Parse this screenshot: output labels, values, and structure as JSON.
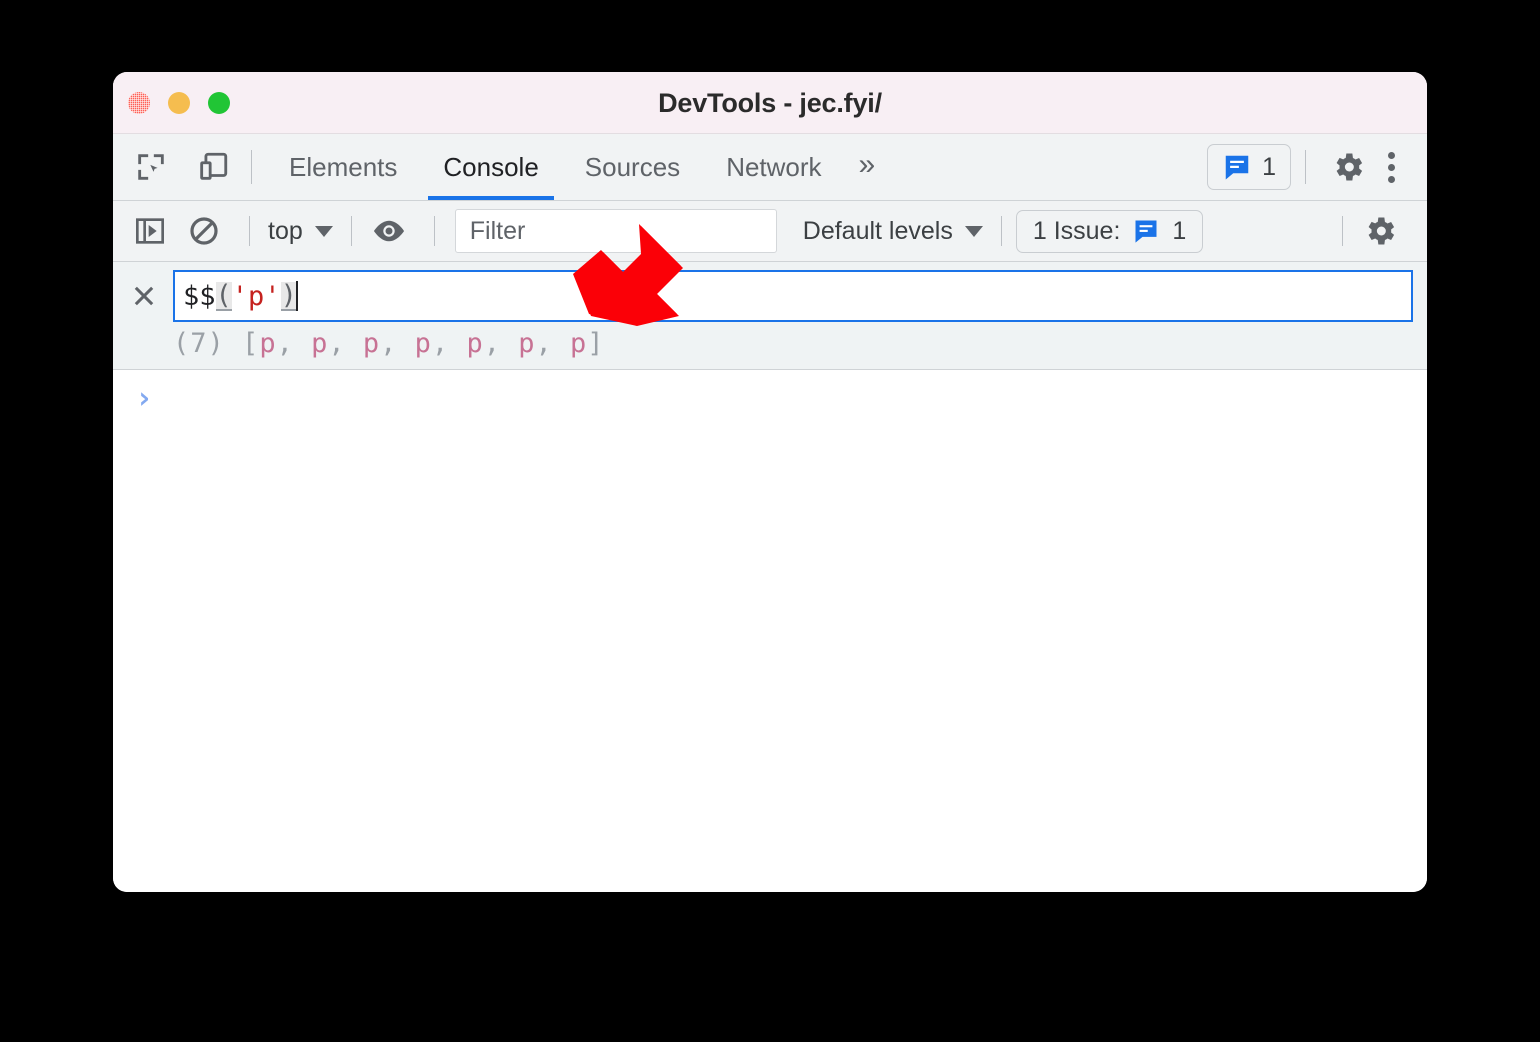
{
  "window": {
    "title": "DevTools - jec.fyi/",
    "traffic_lights": [
      "close",
      "minimize",
      "maximize"
    ]
  },
  "main_tabbar": {
    "inspect_icon": "inspect-element-icon",
    "device_icon": "device-toolbar-icon",
    "tabs": [
      {
        "label": "Elements",
        "active": false
      },
      {
        "label": "Console",
        "active": true
      },
      {
        "label": "Sources",
        "active": false
      },
      {
        "label": "Network",
        "active": false
      }
    ],
    "more_tabs": "»",
    "issues_chip": {
      "icon": "issues-bubble-icon",
      "count": "1"
    },
    "settings_icon": "gear-icon",
    "more_icon": "more-vertical-icon"
  },
  "console_toolbar": {
    "sidebar_toggle_icon": "console-sidebar-icon",
    "clear_console_icon": "clear-console-icon",
    "context_selector": {
      "value": "top",
      "caret": "chevron-down-icon"
    },
    "live_expression_icon": "eye-icon",
    "filter": {
      "placeholder": "Filter",
      "value": ""
    },
    "levels_selector": {
      "value": "Default levels",
      "caret": "chevron-down-icon"
    },
    "issue_counter": {
      "label": "1 Issue:",
      "icon": "issues-bubble-icon",
      "count": "1"
    },
    "settings_icon": "gear-icon"
  },
  "live_expression": {
    "close_icon": "close-icon",
    "tokens": {
      "name": "$$",
      "open_paren": "(",
      "string": "'p'",
      "close_paren": ")"
    },
    "result": {
      "length": "(7)",
      "open_bracket": "[",
      "items": [
        "p",
        "p",
        "p",
        "p",
        "p",
        "p",
        "p"
      ],
      "separator": ", ",
      "close_bracket": "]"
    }
  },
  "console_body": {
    "prompt_chevron": "›"
  },
  "annotation": {
    "arrow": "red-arrow-pointing-down-left",
    "color": "#fb0007"
  },
  "colors": {
    "accent": "#1a73e8",
    "titlebar_bg": "#f8eff4",
    "toolbar_bg": "#f1f3f4",
    "live_expression_bg": "#eff3f4",
    "string_token": "#c5221f",
    "node_token": "#c77294",
    "annotation_red": "#fb0007"
  }
}
